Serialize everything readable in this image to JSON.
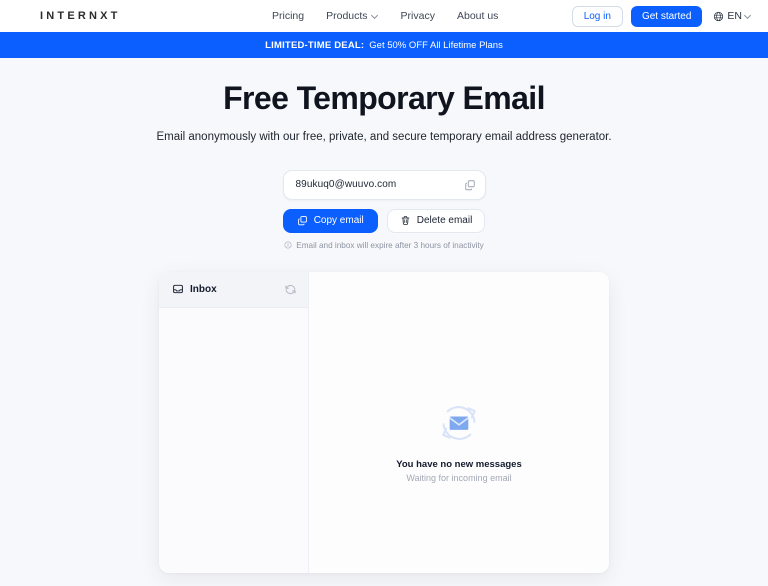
{
  "navbar": {
    "brand": "INTERNXT",
    "links": [
      {
        "label": "Pricing",
        "has_caret": false
      },
      {
        "label": "Products",
        "has_caret": true
      },
      {
        "label": "Privacy",
        "has_caret": false
      },
      {
        "label": "About us",
        "has_caret": false
      }
    ],
    "login_label": "Log in",
    "get_started_label": "Get started",
    "language": "EN",
    "accent_color": "#0b5fff"
  },
  "promo": {
    "strong": "LIMITED-TIME DEAL:",
    "text": "Get 50% OFF All Lifetime Plans",
    "background": "#0b5fff"
  },
  "hero": {
    "title": "Free Temporary Email",
    "subtitle": "Email anonymously with our free, private, and secure temporary email address generator."
  },
  "email_widget": {
    "address": "89ukuq0@wuuvo.com",
    "copy_button_label": "Copy email",
    "delete_button_label": "Delete email",
    "expiry_note": "Email and inbox will expire after 3 hours of inactivity"
  },
  "inbox": {
    "title": "Inbox",
    "messages": [],
    "empty_state": {
      "title": "You have no new messages",
      "subtitle": "Waiting for incoming email",
      "icon_color": "#7fa9ef"
    }
  }
}
